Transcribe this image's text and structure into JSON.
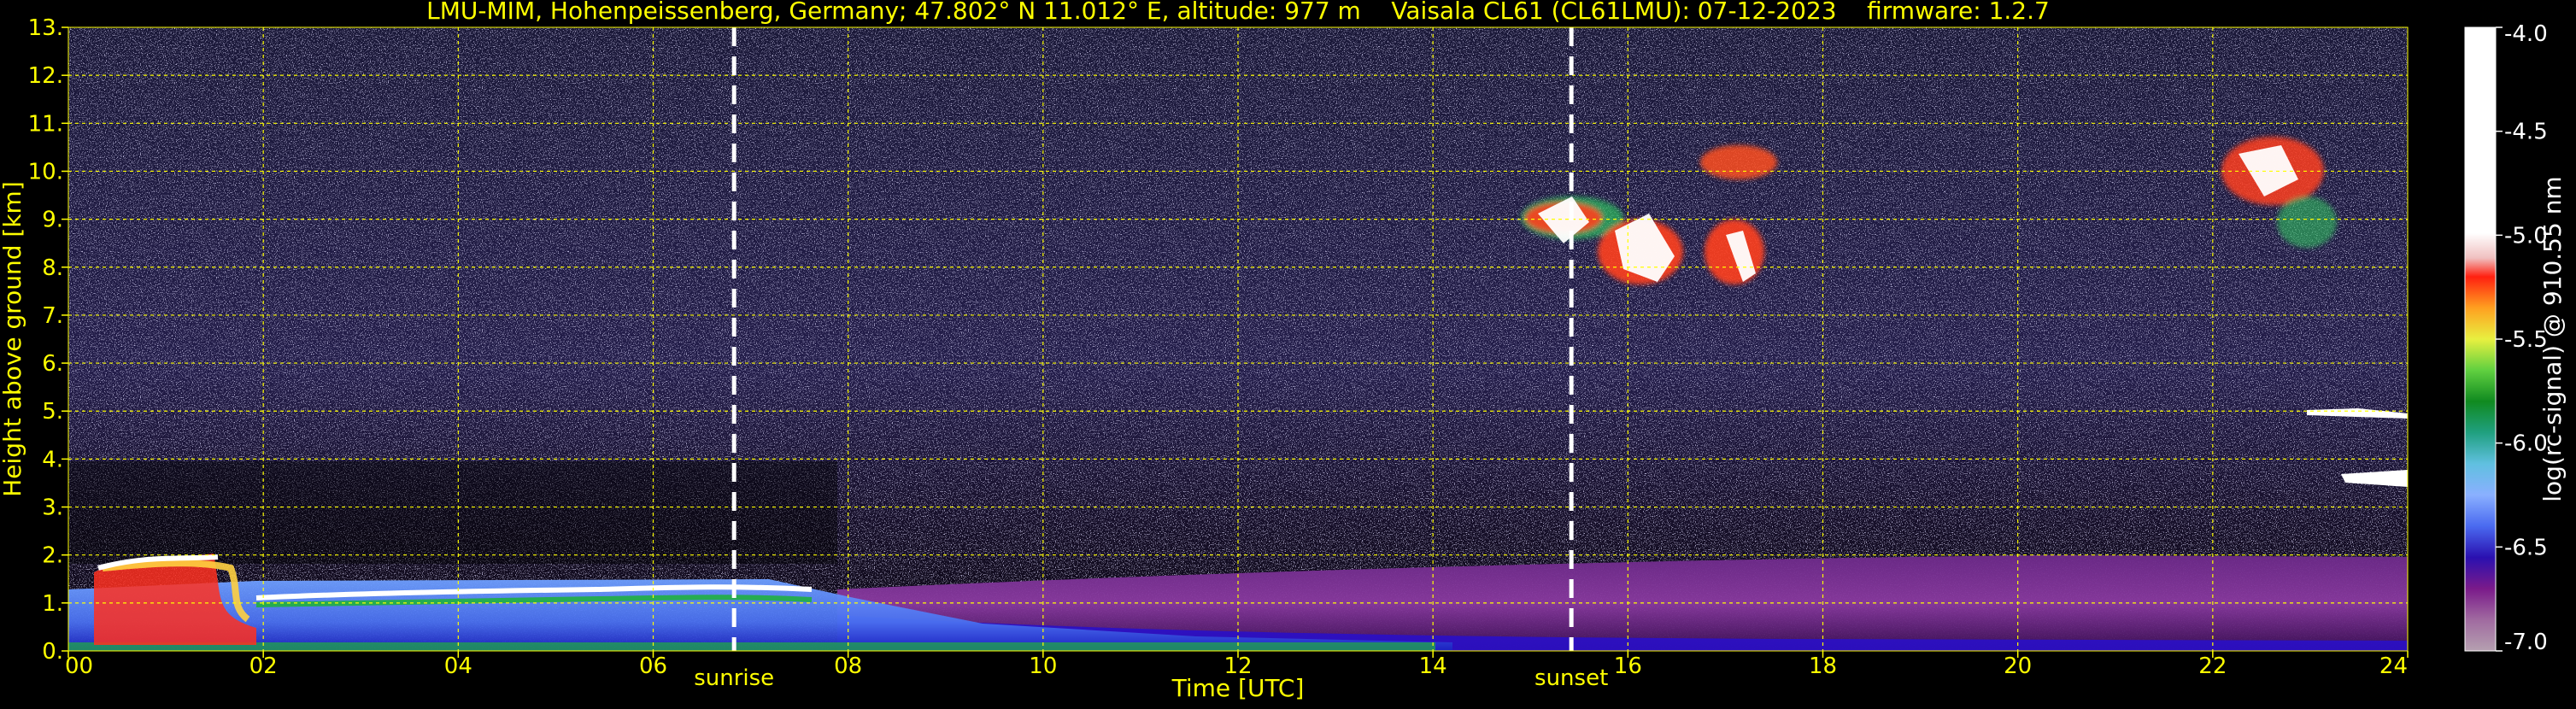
{
  "chart_data": {
    "type": "heatmap",
    "title": "LMU-MIM, Hohenpeissenberg, Germany; 47.802° N 11.012° E, altitude: 977 m    Vaisala CL61 (CL61LMU): 07-12-2023    firmware: 1.2.7",
    "xlabel": "Time [UTC]",
    "ylabel": "Height above ground [km]",
    "colorbar_label": "log(rc-signal) @ 910.55 nm",
    "xlim": [
      0,
      24
    ],
    "ylim": [
      0,
      13
    ],
    "clim": [
      -7.0,
      -4.0
    ],
    "x_ticks": [
      "00",
      "02",
      "04",
      "06",
      "08",
      "10",
      "12",
      "14",
      "16",
      "18",
      "20",
      "22",
      "24"
    ],
    "y_ticks": [
      "0.",
      "1.",
      "2.",
      "3.",
      "4.",
      "5.",
      "6.",
      "7.",
      "8.",
      "9.",
      "10.",
      "11.",
      "12.",
      "13."
    ],
    "colorbar_ticks": [
      "-4.0",
      "-4.5",
      "-5.0",
      "-5.5",
      "-6.0",
      "-6.5",
      "-7.0"
    ],
    "grid": true,
    "grid_color": "#ffff00",
    "text_color": "#ffff00",
    "background": "#000000",
    "annotations": [
      {
        "label": "sunrise",
        "x": 6.83
      },
      {
        "label": "sunset",
        "x": 15.42
      }
    ],
    "features": [
      {
        "name": "low cloud layer",
        "x": [
          0.3,
          1.6
        ],
        "y": [
          0.5,
          1.9
        ]
      },
      {
        "name": "boundary layer top",
        "x": [
          1.6,
          7.5
        ],
        "y": [
          0.9,
          1.35
        ]
      },
      {
        "name": "cirrus cloud",
        "x": [
          14.8,
          18.0
        ],
        "y": [
          7.6,
          10.5
        ]
      },
      {
        "name": "cirrus cloud",
        "x": [
          21.9,
          23.4
        ],
        "y": [
          8.0,
          10.8
        ]
      },
      {
        "name": "mid-level cloud",
        "x": [
          23.0,
          24.0
        ],
        "y": [
          3.3,
          5.0
        ]
      }
    ]
  }
}
